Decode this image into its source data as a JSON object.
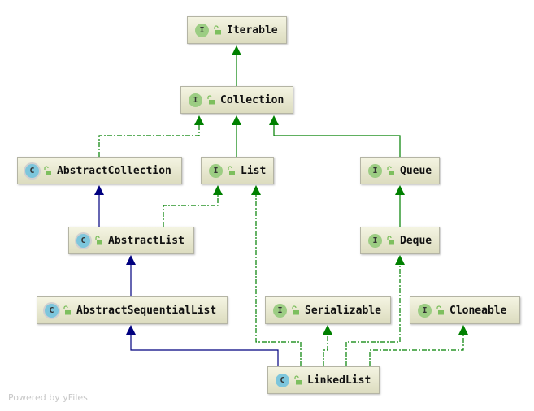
{
  "nodes": {
    "iterable": {
      "name": "Iterable",
      "kind": "I"
    },
    "collection": {
      "name": "Collection",
      "kind": "I"
    },
    "abstract_collection": {
      "name": "AbstractCollection",
      "kind": "C",
      "abstract": true
    },
    "list": {
      "name": "List",
      "kind": "I"
    },
    "queue": {
      "name": "Queue",
      "kind": "I"
    },
    "abstract_list": {
      "name": "AbstractList",
      "kind": "C",
      "abstract": true
    },
    "deque": {
      "name": "Deque",
      "kind": "I"
    },
    "abstract_sequential_list": {
      "name": "AbstractSequentialList",
      "kind": "C",
      "abstract": true
    },
    "serializable": {
      "name": "Serializable",
      "kind": "I"
    },
    "cloneable": {
      "name": "Cloneable",
      "kind": "I"
    },
    "linked_list": {
      "name": "LinkedList",
      "kind": "C"
    }
  },
  "edges": [
    {
      "from": "collection",
      "to": "iterable",
      "type": "interface-extends"
    },
    {
      "from": "abstract_collection",
      "to": "collection",
      "type": "implements"
    },
    {
      "from": "list",
      "to": "collection",
      "type": "interface-extends"
    },
    {
      "from": "queue",
      "to": "collection",
      "type": "interface-extends"
    },
    {
      "from": "abstract_list",
      "to": "abstract_collection",
      "type": "extends"
    },
    {
      "from": "abstract_list",
      "to": "list",
      "type": "implements"
    },
    {
      "from": "deque",
      "to": "queue",
      "type": "interface-extends"
    },
    {
      "from": "abstract_sequential_list",
      "to": "abstract_list",
      "type": "extends"
    },
    {
      "from": "linked_list",
      "to": "abstract_sequential_list",
      "type": "extends"
    },
    {
      "from": "linked_list",
      "to": "list",
      "type": "implements"
    },
    {
      "from": "linked_list",
      "to": "serializable",
      "type": "implements"
    },
    {
      "from": "linked_list",
      "to": "deque",
      "type": "implements"
    },
    {
      "from": "linked_list",
      "to": "cloneable",
      "type": "implements"
    }
  ],
  "colors": {
    "extends": "#00007f",
    "implements": "#008000",
    "interface_icon": "#9ccd83",
    "class_icon": "#7dc6dc"
  },
  "footer": "Powered by yFiles"
}
